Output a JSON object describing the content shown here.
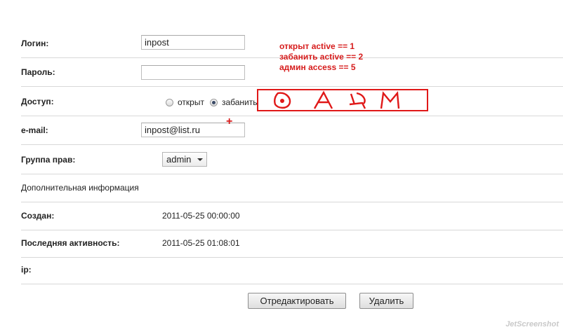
{
  "form": {
    "login": {
      "label": "Логин:",
      "value": "inpost"
    },
    "password": {
      "label": "Пароль:",
      "value": ""
    },
    "access": {
      "label": "Доступ:",
      "options": [
        {
          "label": "открыт",
          "checked": false
        },
        {
          "label": "забанить",
          "checked": true
        }
      ]
    },
    "email": {
      "label": "e-mail:",
      "value": "inpost@list.ru"
    },
    "group": {
      "label": "Группа прав:",
      "selected": "admin"
    },
    "extra_header": "Дополнительная информация",
    "created": {
      "label": "Создан:",
      "value": "2011-05-25 00:00:00"
    },
    "last_activity": {
      "label": "Последняя активность:",
      "value": "2011-05-25 01:08:01"
    },
    "ip": {
      "label": "ip:",
      "value": ""
    }
  },
  "buttons": {
    "edit": "Отредактировать",
    "delete": "Удалить"
  },
  "annotations": {
    "notes": [
      "открыт active == 1",
      "забанить active == 2",
      "админ access == 5"
    ],
    "handwritten": "DAЖM",
    "plus": "+",
    "color": "#d61c1c"
  },
  "watermark": "JetScreenshot"
}
